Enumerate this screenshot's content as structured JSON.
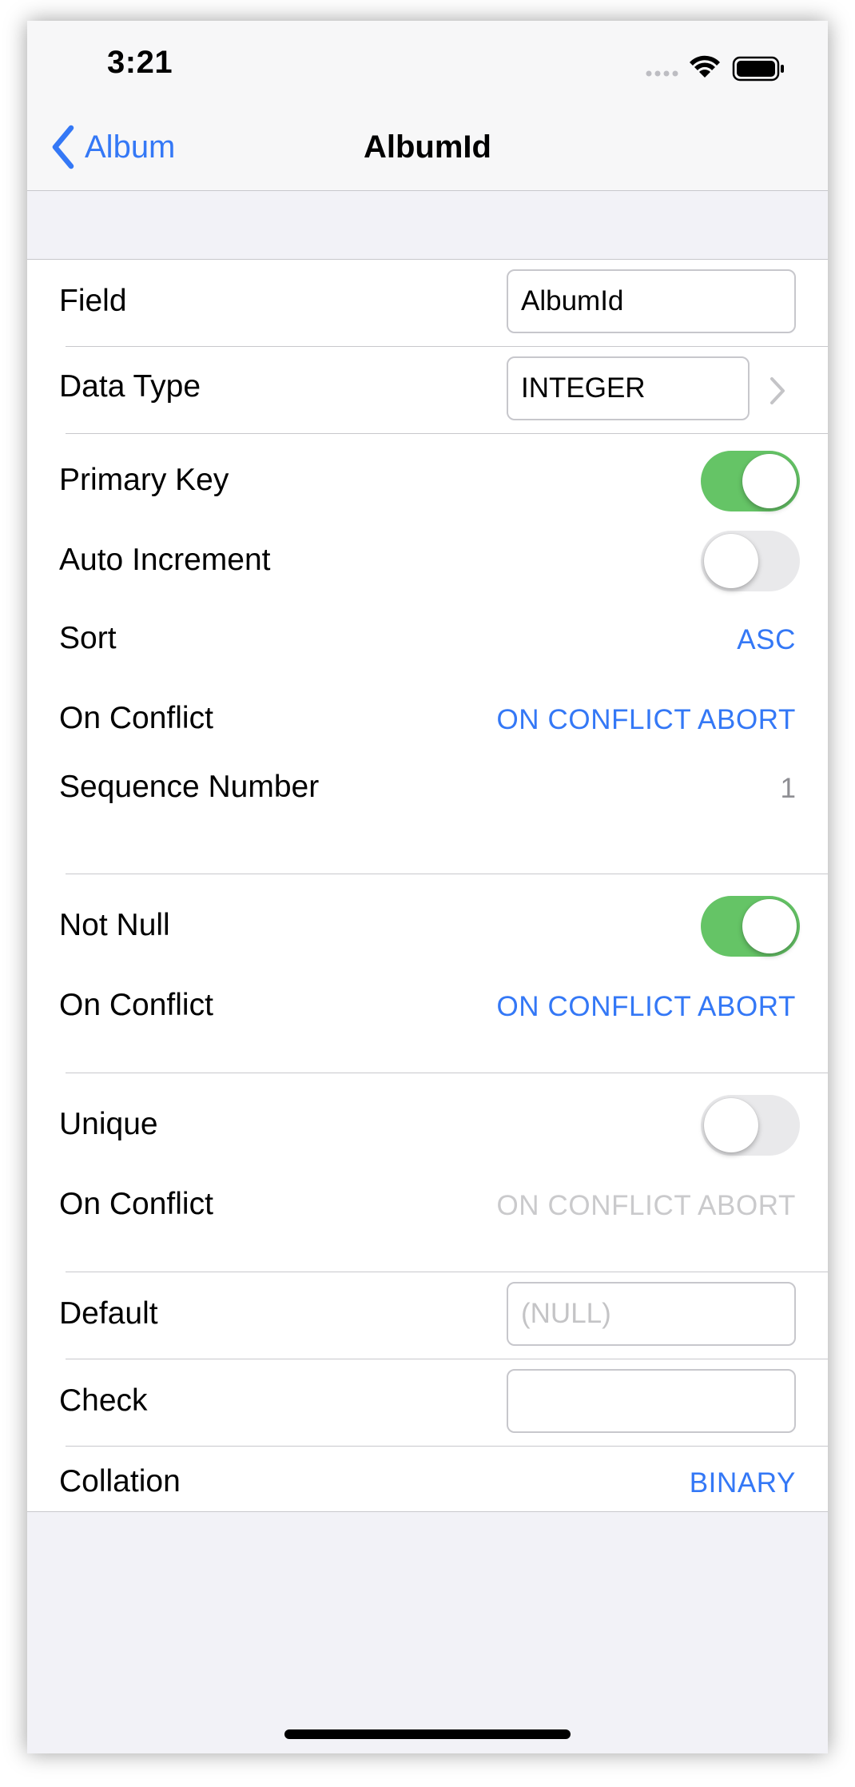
{
  "status_bar": {
    "time": "3:21"
  },
  "nav": {
    "back_label": "Album",
    "title": "AlbumId"
  },
  "field": {
    "label": "Field",
    "value": "AlbumId"
  },
  "data_type": {
    "label": "Data Type",
    "value": "INTEGER"
  },
  "primary_key_group": {
    "primary_key": {
      "label": "Primary Key",
      "on": true
    },
    "auto_increment": {
      "label": "Auto Increment",
      "on": false
    },
    "sort": {
      "label": "Sort",
      "value": "ASC"
    },
    "on_conflict": {
      "label": "On Conflict",
      "value": "ON CONFLICT ABORT"
    },
    "sequence_number": {
      "label": "Sequence Number",
      "value": "1"
    }
  },
  "not_null_group": {
    "not_null": {
      "label": "Not Null",
      "on": true
    },
    "on_conflict": {
      "label": "On Conflict",
      "value": "ON CONFLICT ABORT"
    }
  },
  "unique_group": {
    "unique": {
      "label": "Unique",
      "on": false
    },
    "on_conflict": {
      "label": "On Conflict",
      "value": "ON CONFLICT ABORT",
      "enabled": false
    }
  },
  "default": {
    "label": "Default",
    "value": "",
    "placeholder": "(NULL)"
  },
  "check": {
    "label": "Check",
    "value": ""
  },
  "collation": {
    "label": "Collation",
    "value": "BINARY"
  },
  "colors": {
    "accent": "#3478f6",
    "toggle_on": "#65c466",
    "toggle_off": "#e9e9eb",
    "disabled_text": "#cacacc",
    "background": "#f2f2f7"
  },
  "icons": [
    "signal-dots-icon",
    "wifi-icon",
    "battery-icon",
    "back-chevron-icon",
    "disclosure-chevron-icon"
  ]
}
